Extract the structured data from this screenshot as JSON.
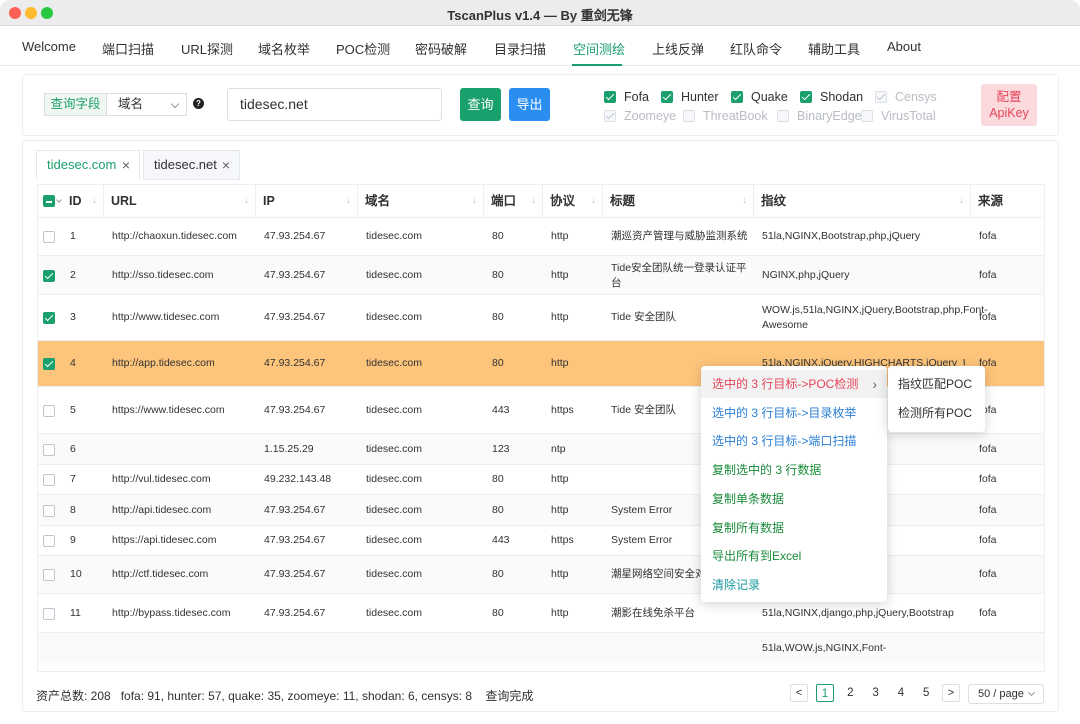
{
  "window_title": "TscanPlus v1.4 — By 重剑无锋",
  "menu": [
    "Welcome",
    "端口扫描",
    "URL探测",
    "域名枚举",
    "POC检测",
    "密码破解",
    "目录扫描",
    "空间测绘",
    "上线反弹",
    "红队命令",
    "辅助工具",
    "About"
  ],
  "active_menu": "空间测绘",
  "query": {
    "field_label": "查询字段",
    "field_value": "域名",
    "help": "?",
    "input_value": "tidesec.net",
    "query_btn": "查询",
    "export_btn": "导出"
  },
  "engines": [
    {
      "name": "Fofa",
      "checked": true,
      "disabled": false
    },
    {
      "name": "Hunter",
      "checked": true,
      "disabled": false
    },
    {
      "name": "Quake",
      "checked": true,
      "disabled": false
    },
    {
      "name": "Shodan",
      "checked": true,
      "disabled": false
    },
    {
      "name": "Censys",
      "checked": true,
      "disabled": true
    },
    {
      "name": "Zoomeye",
      "checked": true,
      "disabled": true
    },
    {
      "name": "ThreatBook",
      "checked": false,
      "disabled": true
    },
    {
      "name": "BinaryEdge",
      "checked": false,
      "disabled": true
    },
    {
      "name": "VirusTotal",
      "checked": false,
      "disabled": true
    }
  ],
  "apikey_btn": [
    "配置",
    "ApiKey"
  ],
  "tabs": [
    {
      "label": "tidesec.com",
      "active": true
    },
    {
      "label": "tidesec.net",
      "active": false
    }
  ],
  "columns": [
    "ID",
    "URL",
    "IP",
    "域名",
    "端口",
    "协议",
    "标题",
    "指纹",
    "来源"
  ],
  "rows": [
    {
      "checked": false,
      "id": "1",
      "url": "http://chaoxun.tidesec.com",
      "ip": "47.93.254.67",
      "domain": "tidesec.com",
      "port": "80",
      "proto": "http",
      "title": "潮巡资产管理与威胁监测系统",
      "fp": "51la,NGINX,Bootstrap,php,jQuery",
      "src": "fofa"
    },
    {
      "checked": true,
      "id": "2",
      "url": "http://sso.tidesec.com",
      "ip": "47.93.254.67",
      "domain": "tidesec.com",
      "port": "80",
      "proto": "http",
      "title": "Tide安全团队统一登录认证平台",
      "fp": "NGINX,php,jQuery",
      "src": "fofa"
    },
    {
      "checked": true,
      "id": "3",
      "url": "http://www.tidesec.com",
      "ip": "47.93.254.67",
      "domain": "tidesec.com",
      "port": "80",
      "proto": "http",
      "title": "Tide 安全团队",
      "fp": "WOW.js,51la,NGINX,jQuery,Bootstrap,php,Font-Awesome",
      "src": "fofa"
    },
    {
      "checked": true,
      "id": "4",
      "url": "http://app.tidesec.com",
      "ip": "47.93.254.67",
      "domain": "tidesec.com",
      "port": "80",
      "proto": "http",
      "title": "",
      "fp": "51la,NGINX,jQuery,HIGHCHARTS,jQuery_U",
      "src": "fofa"
    },
    {
      "checked": false,
      "id": "5",
      "url": "https://www.tidesec.com",
      "ip": "47.93.254.67",
      "domain": "tidesec.com",
      "port": "443",
      "proto": "https",
      "title": "Tide 安全团队",
      "fp": "",
      "src": "fofa"
    },
    {
      "checked": false,
      "id": "6",
      "url": "",
      "ip": "1.15.25.29",
      "domain": "tidesec.com",
      "port": "123",
      "proto": "ntp",
      "title": "",
      "fp": "",
      "src": "fofa"
    },
    {
      "checked": false,
      "id": "7",
      "url": "http://vul.tidesec.com",
      "ip": "49.232.143.48",
      "domain": "tidesec.com",
      "port": "80",
      "proto": "http",
      "title": "",
      "fp": "",
      "src": "fofa"
    },
    {
      "checked": false,
      "id": "8",
      "url": "http://api.tidesec.com",
      "ip": "47.93.254.67",
      "domain": "tidesec.com",
      "port": "80",
      "proto": "http",
      "title": "System Error",
      "fp": "",
      "src": "fofa"
    },
    {
      "checked": false,
      "id": "9",
      "url": "https://api.tidesec.com",
      "ip": "47.93.254.67",
      "domain": "tidesec.com",
      "port": "443",
      "proto": "https",
      "title": "System Error",
      "fp": "",
      "src": "fofa"
    },
    {
      "checked": false,
      "id": "10",
      "url": "http://ctf.tidesec.com",
      "ip": "47.93.254.67",
      "domain": "tidesec.com",
      "port": "80",
      "proto": "http",
      "title": "潮星网络空间安全对抗平台",
      "fp": "",
      "src": "fofa"
    },
    {
      "checked": false,
      "id": "11",
      "url": "http://bypass.tidesec.com",
      "ip": "47.93.254.67",
      "domain": "tidesec.com",
      "port": "80",
      "proto": "http",
      "title": "潮影在线免杀平台",
      "fp": "51la,NGINX,django,php,jQuery,Bootstrap",
      "src": "fofa"
    },
    {
      "checked": false,
      "id": "",
      "url": "",
      "ip": "",
      "domain": "",
      "port": "",
      "proto": "",
      "title": "",
      "fp": "51la,WOW.js,NGINX,Font-",
      "src": ""
    }
  ],
  "context_menu": [
    {
      "label": "选中的 3 行目标->POC检测",
      "color": "#e5455a",
      "submenu": true
    },
    {
      "label": "选中的 3 行目标->目录枚举",
      "color": "#2a7fd4"
    },
    {
      "label": "选中的 3 行目标->端口扫描",
      "color": "#2a7fd4"
    },
    {
      "label": "复制选中的 3 行数据",
      "color": "#1a8a3a"
    },
    {
      "label": "复制单条数据",
      "color": "#1a8a3a"
    },
    {
      "label": "复制所有数据",
      "color": "#1a8a3a"
    },
    {
      "label": "导出所有到Excel",
      "color": "#1a8a3a"
    },
    {
      "label": "清除记录",
      "color": "#1a9aa0"
    }
  ],
  "submenu": [
    "指纹匹配POC",
    "检测所有POC"
  ],
  "status": "资产总数: 208   fofa: 91, hunter: 57, quake: 35, zoomeye: 11, shodan: 6, censys: 8    查询完成",
  "pager": {
    "prev": "<",
    "pages": [
      "1",
      "2",
      "3",
      "4",
      "5"
    ],
    "current": "1",
    "next": ">",
    "size": "50 / page"
  }
}
